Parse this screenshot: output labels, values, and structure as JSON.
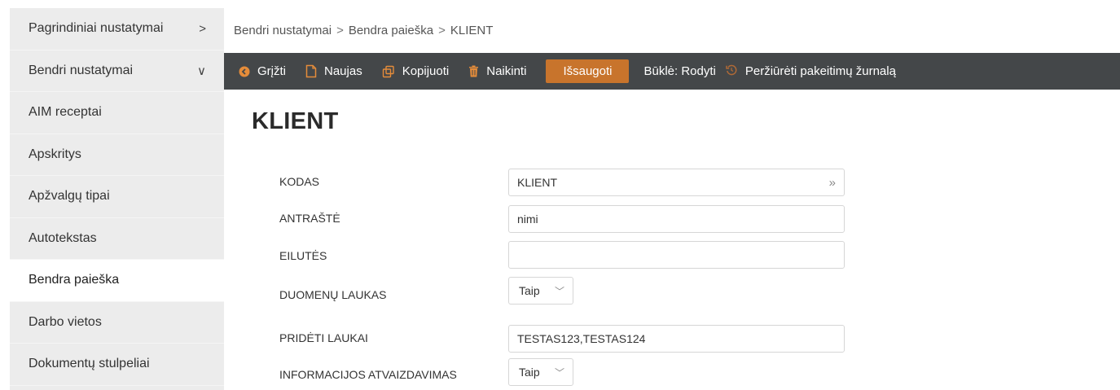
{
  "sidebar": {
    "items": [
      {
        "label": "Pagrindiniai nustatymai",
        "chevron": ">"
      },
      {
        "label": "Bendri nustatymai",
        "chevron": "∨"
      },
      {
        "label": "AIM receptai"
      },
      {
        "label": "Apskritys"
      },
      {
        "label": "Apžvalgų tipai"
      },
      {
        "label": "Autotekstas"
      },
      {
        "label": "Bendra paieška"
      },
      {
        "label": "Darbo vietos"
      },
      {
        "label": "Dokumentų stulpeliai"
      }
    ]
  },
  "breadcrumb": {
    "items": [
      "Bendri nustatymai",
      "Bendra paieška",
      "KLIENT"
    ],
    "separator": ">"
  },
  "toolbar": {
    "back_label": "Grįžti",
    "new_label": "Naujas",
    "copy_label": "Kopijuoti",
    "delete_label": "Naikinti",
    "save_label": "Išsaugoti",
    "status_label": "Būklė: Rodyti",
    "journal_label": "Peržiūrėti pakeitimų žurnalą"
  },
  "page": {
    "title": "KLIENT"
  },
  "form": {
    "kodas": {
      "label": "KODAS",
      "value": "KLIENT"
    },
    "antraste": {
      "label": "ANTRAŠTĖ",
      "value": "nimi"
    },
    "eilutes": {
      "label": "EILUTĖS",
      "value": ""
    },
    "duomenu_laukas": {
      "label": "DUOMENŲ LAUKAS",
      "value": "Taip"
    },
    "prideti_laukai": {
      "label": "PRIDĖTI LAUKAI",
      "value": "TESTAS123,TESTAS124"
    },
    "informacijos_atvaizdavimas": {
      "label": "INFORMACIJOS ATVAIZDAVIMAS",
      "value": "Taip"
    }
  },
  "colors": {
    "toolbar_bg": "#444749",
    "accent": "#c8742c",
    "icon": "#e58c3a",
    "sidebar_bg": "#ececec"
  },
  "icons": {
    "back": "arrow-circle-left-icon",
    "new": "file-icon",
    "copy": "copy-icon",
    "delete": "trash-icon",
    "journal": "history-icon"
  }
}
